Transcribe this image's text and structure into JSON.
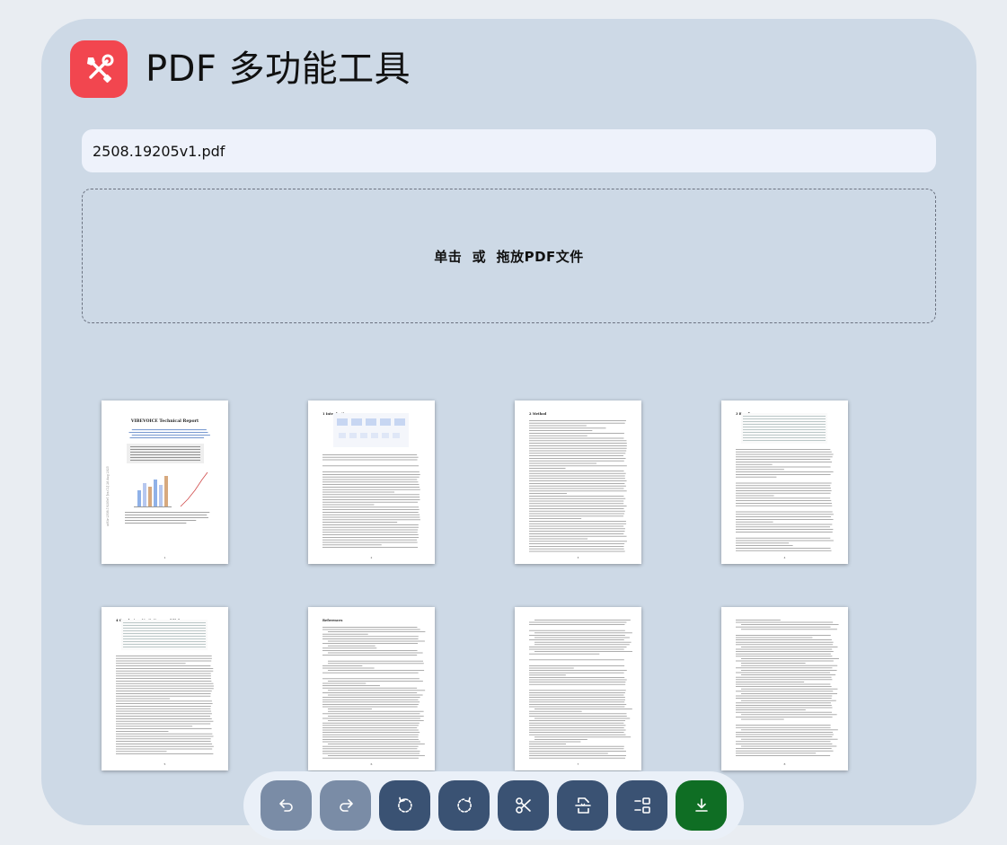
{
  "app": {
    "title": "PDF 多功能工具",
    "icon": "tools-icon",
    "accent_color": "#f2464f"
  },
  "file_field": {
    "value": "2508.19205v1.pdf"
  },
  "dropzone": {
    "label": "单击  或  拖放PDF文件"
  },
  "pages": [
    {
      "number": "1",
      "heading": "VIBEVOICE Technical Report",
      "side_note": "arXiv:2508.19205v1 [cs.CL] 26 Aug 2025"
    },
    {
      "number": "2",
      "heading": "1  Introduction",
      "side_note": ""
    },
    {
      "number": "3",
      "heading": "2  Method",
      "side_note": ""
    },
    {
      "number": "4",
      "heading": "3  Results",
      "side_note": ""
    },
    {
      "number": "5",
      "heading": "4  Conclusion, Limitations, and Risks",
      "side_note": ""
    },
    {
      "number": "6",
      "heading": "References",
      "side_note": ""
    },
    {
      "number": "7",
      "heading": "",
      "side_note": ""
    },
    {
      "number": "8",
      "heading": "",
      "side_note": ""
    }
  ],
  "toolbar": {
    "buttons": [
      {
        "name": "undo-button",
        "icon": "undo-icon",
        "state": "disabled"
      },
      {
        "name": "redo-button",
        "icon": "redo-icon",
        "state": "disabled"
      },
      {
        "name": "rotate-left-button",
        "icon": "rotate-left-icon",
        "state": "active"
      },
      {
        "name": "rotate-right-button",
        "icon": "rotate-right-icon",
        "state": "active"
      },
      {
        "name": "split-button",
        "icon": "scissors-icon",
        "state": "active"
      },
      {
        "name": "compress-button",
        "icon": "compress-file-icon",
        "state": "active"
      },
      {
        "name": "organize-button",
        "icon": "organize-icon",
        "state": "active"
      },
      {
        "name": "download-button",
        "icon": "download-icon",
        "state": "primary"
      }
    ],
    "colors": {
      "disabled": "#7a8ca6",
      "active": "#3a5273",
      "primary": "#0f6e24"
    }
  }
}
